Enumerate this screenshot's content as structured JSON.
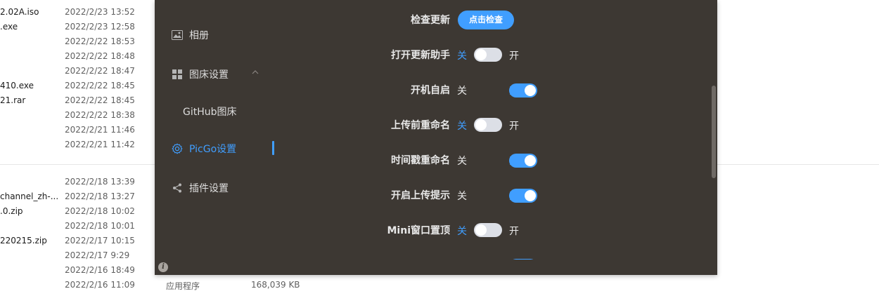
{
  "explorer": {
    "rows": [
      {
        "name": "2.02A.iso",
        "date": "2022/2/23 13:52"
      },
      {
        "name": ".exe",
        "date": "2022/2/23 12:58"
      },
      {
        "name": "",
        "date": "2022/2/22 18:53"
      },
      {
        "name": "",
        "date": "2022/2/22 18:48"
      },
      {
        "name": "",
        "date": "2022/2/22 18:47"
      },
      {
        "name": "410.exe",
        "date": "2022/2/22 18:45"
      },
      {
        "name": "21.rar",
        "date": "2022/2/22 18:45"
      },
      {
        "name": "",
        "date": "2022/2/22 18:38"
      },
      {
        "name": "",
        "date": "2022/2/21 11:46"
      },
      {
        "name": "",
        "date": "2022/2/21 11:42"
      },
      {
        "name": "",
        "date": "2022/2/18 13:39"
      },
      {
        "name": "channel_zh-...",
        "date": "2022/2/18 13:27"
      },
      {
        "name": ".0.zip",
        "date": "2022/2/18 10:02"
      },
      {
        "name": "",
        "date": "2022/2/18 10:01"
      },
      {
        "name": "220215.zip",
        "date": "2022/2/17 10:15"
      },
      {
        "name": "",
        "date": "2022/2/17 9:29"
      },
      {
        "name": "",
        "date": "2022/2/16 18:49"
      },
      {
        "name": "",
        "date": "2022/2/16 11:09"
      }
    ],
    "last_row_type": "应用程序",
    "last_row_size": "168,039 KB"
  },
  "sidebar": {
    "items": [
      {
        "label": "相册",
        "icon": "image-icon"
      },
      {
        "label": "图床设置",
        "icon": "grid-icon"
      },
      {
        "label": "GitHub图床",
        "icon": ""
      },
      {
        "label": "PicGo设置",
        "icon": "gear-icon"
      },
      {
        "label": "插件设置",
        "icon": "share-icon"
      }
    ],
    "active": "PicGo设置"
  },
  "settings": {
    "check_update_label": "检查更新",
    "check_update_button": "点击检查",
    "off_text": "关",
    "on_text": "开",
    "toggles": [
      {
        "label": "打开更新助手",
        "on": false
      },
      {
        "label": "开机自启",
        "on": true
      },
      {
        "label": "上传前重命名",
        "on": false
      },
      {
        "label": "时间戳重命名",
        "on": true
      },
      {
        "label": "开启上传提示",
        "on": true
      },
      {
        "label": "Mini窗口置顶",
        "on": false
      },
      {
        "label": "",
        "on": true
      }
    ]
  },
  "colors": {
    "window_bg": "#3d3833",
    "accent": "#409eff",
    "switch_off": "#dcdfe6"
  }
}
